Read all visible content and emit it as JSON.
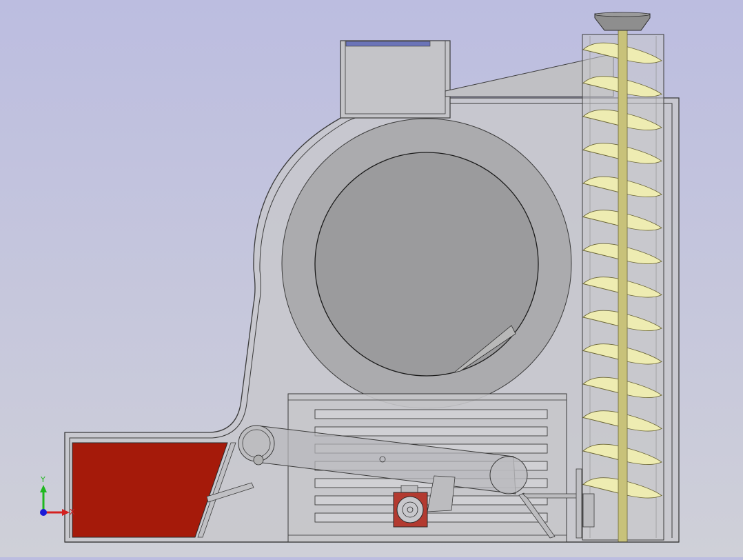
{
  "viewport": {
    "background_top": "#bcbde0",
    "background_bottom": "#cfd0d8"
  },
  "colors": {
    "housing_fill": "#c8c8cc",
    "housing_stroke": "#3a3a3a",
    "drum_fill": "#9d9d9d",
    "hopper_fill": "#a51a0a",
    "screw_flight": "#eeecb2",
    "screw_shaft": "#c8c27a",
    "motor_red": "#b33a30"
  },
  "triad": {
    "y_label": "Y",
    "x_label": "X",
    "y_color": "#1fb81f",
    "x_color": "#d42020",
    "z_color": "#1a1ad8"
  }
}
